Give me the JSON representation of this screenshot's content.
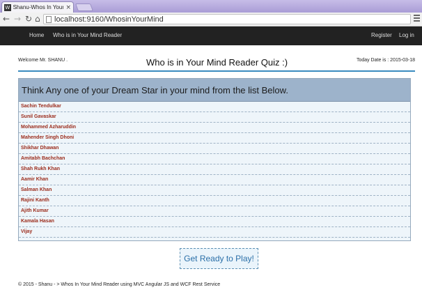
{
  "browser": {
    "tab_title": "Shanu-Whos In Your Min",
    "tab_favicon": "W",
    "url": "localhost:9160/WhosinYourMind"
  },
  "icons": {
    "back": "back-arrow-icon",
    "forward": "forward-arrow-icon",
    "reload": "reload-icon",
    "home": "home-icon",
    "close": "close-icon",
    "menu": "menu-icon"
  },
  "navbar": {
    "links": [
      "Home",
      "Who is in Your Mind Reader"
    ],
    "right_links": [
      "Register",
      "Log in"
    ]
  },
  "header": {
    "welcome": "Welcome Mr. SHANU .",
    "title": "Who is in Your Mind Reader Quiz :)",
    "today": "Today Date is : 2015-03-18"
  },
  "panel": {
    "heading": "Think Any one of your Dream Star in your mind from the list Below.",
    "stars": [
      "Sachin Tendulkar",
      "Sunil Gavaskar",
      "Mohammed Azharuddin",
      "Mahender Singh Dhoni",
      "Shikhar Dhawan",
      "Amitabh Bachchan",
      "Shah Rukh Khan",
      "Aamir Khan",
      "Salman Khan",
      "Rajini Kanth",
      "Ajith Kumar",
      "Kamala Hasan",
      "Vijay"
    ]
  },
  "play_button": "Get Ready to Play!",
  "footer": "© 2015 - Shanu - > Whos In Your Mind Reader using MVC Angular JS and WCF Rest Service",
  "colors": {
    "navbar_bg": "#222222",
    "panel_header_bg": "#9db3cb",
    "star_text": "#9b2b1b",
    "accent": "#3a8bbf"
  }
}
